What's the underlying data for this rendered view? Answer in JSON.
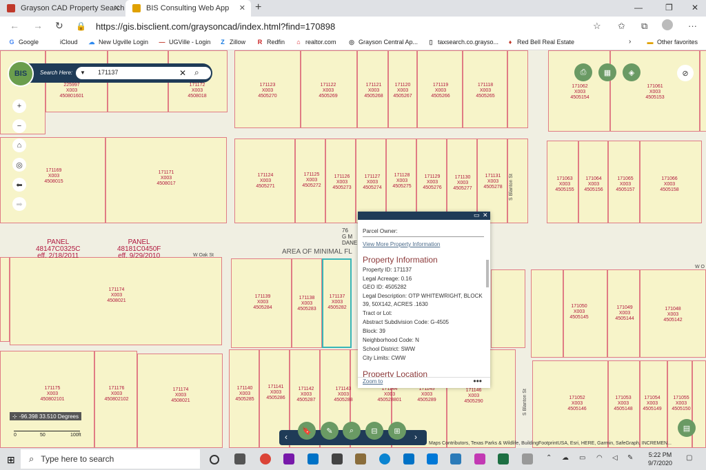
{
  "browser": {
    "tabs": [
      {
        "title": "Grayson CAD Property Search"
      },
      {
        "title": "BIS Consulting Web App"
      }
    ],
    "url": "https://gis.bisclient.com/graysoncad/index.html?find=170898",
    "favorites": [
      "Google",
      "iCloud",
      "New Ugville Login",
      "UGVille - Login",
      "Zillow",
      "Redfin",
      "realtor.com",
      "Grayson Central Ap...",
      "taxsearch.co.grayso...",
      "Red Bell Real Estate"
    ],
    "other_favorites": "Other favorites"
  },
  "search": {
    "label": "Search Here:",
    "value": "171137"
  },
  "map": {
    "parcels_top": [
      {
        "id": "171123",
        "code": "X003",
        "geo": "4505270"
      },
      {
        "id": "171122",
        "code": "X003",
        "geo": "4505269"
      },
      {
        "id": "171121",
        "code": "X003",
        "geo": "4505268"
      },
      {
        "id": "171120",
        "code": "X003",
        "geo": "4505267"
      },
      {
        "id": "171119",
        "code": "X003",
        "geo": "4505266"
      },
      {
        "id": "171118",
        "code": "X003",
        "geo": "4505265"
      },
      {
        "id": "171062",
        "code": "X003",
        "geo": "4505154"
      },
      {
        "id": "171061",
        "code": "X003",
        "geo": "4505153"
      },
      {
        "id": "171172",
        "code": "X003",
        "geo": "4508018"
      },
      {
        "id": "225997",
        "code": "X003",
        "geo": "450801601"
      }
    ],
    "parcels_mid": [
      {
        "id": "171169",
        "code": "X003",
        "geo": "4508015"
      },
      {
        "id": "171171",
        "code": "X003",
        "geo": "4508017"
      },
      {
        "id": "171124",
        "code": "X003",
        "geo": "4505271"
      },
      {
        "id": "171125",
        "code": "X003",
        "geo": "4505272"
      },
      {
        "id": "171126",
        "code": "X003",
        "geo": "4505273"
      },
      {
        "id": "171127",
        "code": "X003",
        "geo": "4505274"
      },
      {
        "id": "171128",
        "code": "X003",
        "geo": "4505275"
      },
      {
        "id": "171129",
        "code": "X003",
        "geo": "4505276"
      },
      {
        "id": "171130",
        "code": "X003",
        "geo": "4505277"
      },
      {
        "id": "171131",
        "code": "X003",
        "geo": "4505278"
      },
      {
        "id": "171063",
        "code": "X003",
        "geo": "4505155"
      },
      {
        "id": "171064",
        "code": "X003",
        "geo": "4505156"
      },
      {
        "id": "171065",
        "code": "X003",
        "geo": "4505157"
      },
      {
        "id": "171066",
        "code": "X003",
        "geo": "4505158"
      }
    ],
    "parcels_low": [
      {
        "id": "171174",
        "code": "X003",
        "geo": "4508021"
      },
      {
        "id": "171139",
        "code": "X003",
        "geo": "4505284"
      },
      {
        "id": "171138",
        "code": "X003",
        "geo": "4505283"
      },
      {
        "id": "171137",
        "code": "X003",
        "geo": "4505282"
      },
      {
        "id": "171050",
        "code": "X003",
        "geo": "4505145"
      },
      {
        "id": "171049",
        "code": "X003",
        "geo": "4505144"
      },
      {
        "id": "171048",
        "code": "X003",
        "geo": "4505142"
      }
    ],
    "parcels_bottom": [
      {
        "id": "171175",
        "code": "X003",
        "geo": "450802101"
      },
      {
        "id": "171176",
        "code": "X003",
        "geo": "450802102"
      },
      {
        "id": "171174",
        "code": "X003",
        "geo": "4508021"
      },
      {
        "id": "171140",
        "code": "X003",
        "geo": "4505285"
      },
      {
        "id": "171141",
        "code": "X003",
        "geo": "4505286"
      },
      {
        "id": "171142",
        "code": "X003",
        "geo": "4505287"
      },
      {
        "id": "171143",
        "code": "X003",
        "geo": "4505288"
      },
      {
        "id": "171144",
        "code": "X003",
        "geo": "450528801"
      },
      {
        "id": "171145",
        "code": "X003",
        "geo": "4505289"
      },
      {
        "id": "171146",
        "code": "X003",
        "geo": "4505290"
      },
      {
        "id": "171052",
        "code": "X003",
        "geo": "4505146"
      },
      {
        "id": "171053",
        "code": "X003",
        "geo": "4505148"
      },
      {
        "id": "171054",
        "code": "X003",
        "geo": "4505149"
      },
      {
        "id": "171055",
        "code": "X003",
        "geo": "4505150"
      }
    ],
    "streets": {
      "oak": "W Oak St",
      "oak_right": "W O",
      "blanton": "S Blanton St",
      "blanton_low": "S Blanton St"
    },
    "flood_text": "AREA OF MINIMAL FL",
    "panels": [
      {
        "label": "PANEL",
        "id": "48147C0325C",
        "eff": "eff. 2/18/2011"
      },
      {
        "label": "PANEL",
        "id": "48181C0450F",
        "eff": "eff. 9/29/2010"
      }
    ],
    "partial_label": "76\nG M\nDANE",
    "coords": "-96.398 33.510 Degrees",
    "scale_labels": [
      "0",
      "50",
      "100ft"
    ],
    "attribution": "Maps Contributors, Texas Parks & Wildlife, BuildingFootprintUSA, Esri, HERE, Garmin, SafeGraph, INCREMEN..."
  },
  "popup": {
    "owner_label": "Parcel Owner:",
    "view_more": "View More Property Information",
    "section_title": "Property Information",
    "rows": [
      {
        "k": "Property ID:",
        "v": "171137"
      },
      {
        "k": "Legal Acreage:",
        "v": "0.16"
      },
      {
        "k": "GEO ID:",
        "v": "4505282"
      },
      {
        "k": "Legal Description:",
        "v": "OTP WHITEWRIGHT, BLOCK 39, 50X142, ACRES .1630"
      },
      {
        "k": "Tract or Lot:",
        "v": ""
      },
      {
        "k": "Abstract Subdivision Code:",
        "v": "G-4505"
      },
      {
        "k": "Block:",
        "v": "39"
      },
      {
        "k": "Neighborhood Code:",
        "v": "N"
      },
      {
        "k": "School District:",
        "v": "SWW"
      },
      {
        "k": "City Limits:",
        "v": "CWW"
      }
    ],
    "next_section": "Property Location",
    "zoom_link": "Zoom to",
    "more": "•••"
  },
  "taskbar": {
    "search_placeholder": "Type here to search",
    "time": "5:22 PM",
    "date": "9/7/2020"
  }
}
